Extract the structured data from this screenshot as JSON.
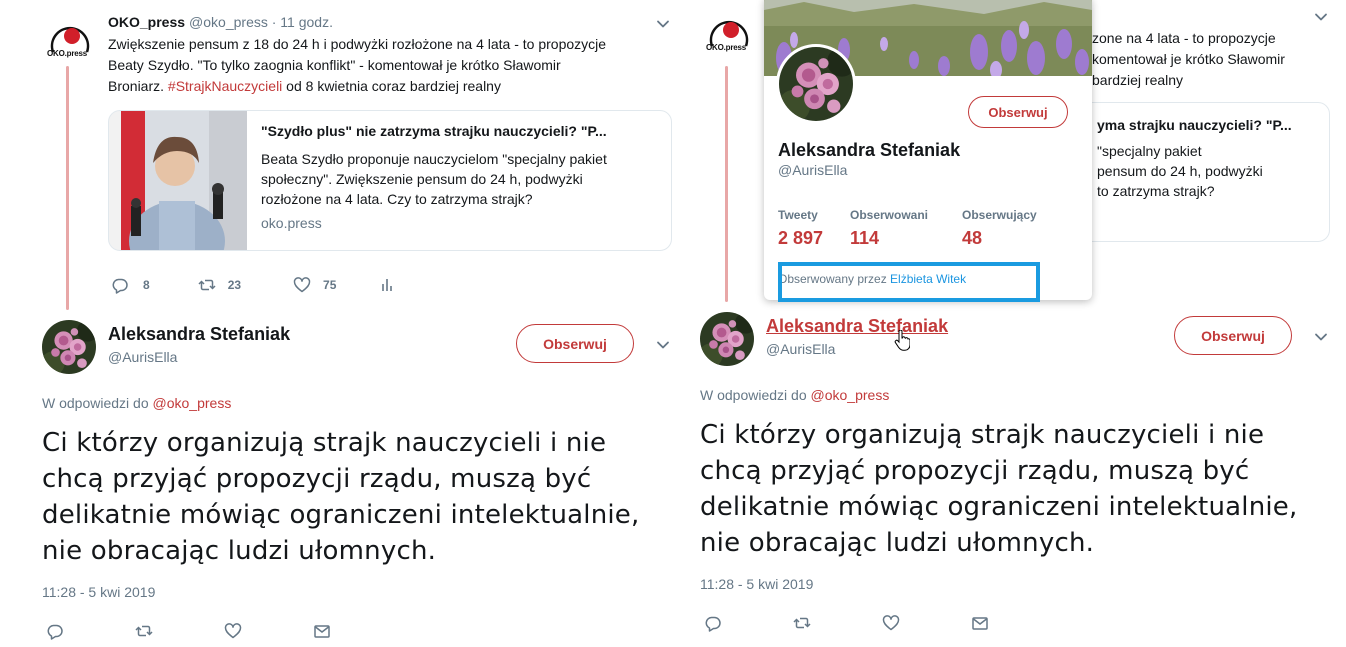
{
  "colors": {
    "accent": "#c23a3a",
    "link_blue": "#1b95e0",
    "muted": "#657786",
    "highlight": "#1a9be0"
  },
  "left": {
    "quoted_tweet": {
      "logo_text": "OKO.press",
      "author_name": "OKO_press",
      "author_meta": "@oko_press · 11 godz.",
      "text_lines": [
        "Zwiększenie pensum z 18 do 24 h i podwyżki rozłożone na 4 lata - to propozycje",
        "Beaty Szydło. \"To tylko zaognia konflikt\" - komentował je krótko Sławomir"
      ],
      "text_line3_before": "Broniarz. ",
      "hashtag": "#StrajkNauczycieli",
      "text_line3_after": " od 8 kwietnia coraz bardziej realny",
      "card": {
        "title": "\"Szydło plus\" nie zatrzyma strajku nauczycieli? \"P...",
        "description_lines": [
          "Beata Szydło proponuje nauczycielom \"specjalny pakiet",
          "społeczny\". Zwiększenie pensum do 24 h, podwyżki",
          "rozłożone na 4 lata. Czy to zatrzyma strajk?"
        ],
        "domain": "oko.press"
      },
      "actions": {
        "replies": "8",
        "retweets": "23",
        "likes": "75"
      }
    },
    "reply": {
      "name": "Aleksandra Stefaniak",
      "handle": "@AurisElla",
      "follow_label": "Obserwuj",
      "reply_prefix": "W odpowiedzi do ",
      "reply_mention": "@oko_press",
      "text_lines": [
        "Ci którzy organizują strajk nauczycieli i nie",
        "chcą przyjąć propozycji rządu, muszą być",
        "delikatnie mówiąc ograniczeni intelektualnie,",
        "nie obracając ludzi ułomnych."
      ],
      "timestamp": "11:28 - 5 kwi 2019"
    }
  },
  "right": {
    "quoted_tweet": {
      "text_lines": [
        "zone na 4 lata - to propozycje",
        "komentował je krótko Sławomir",
        "bardziej realny"
      ],
      "card": {
        "title": "yma strajku nauczycieli? \"P...",
        "description_lines": [
          "\"specjalny pakiet",
          "pensum do 24 h, podwyżki",
          "to zatrzyma strajk?"
        ]
      }
    },
    "hovercard": {
      "name": "Aleksandra Stefaniak",
      "handle": "@AurisElla",
      "follow_label": "Obserwuj",
      "stats": [
        {
          "label": "Tweety",
          "value": "2 897"
        },
        {
          "label": "Obserwowani",
          "value": "114"
        },
        {
          "label": "Obserwujący",
          "value": "48"
        }
      ],
      "followed_by_prefix": "Obserwowany przez ",
      "followed_by_name": "Elżbieta Witek"
    },
    "reply": {
      "name": "Aleksandra Stefaniak",
      "handle": "@AurisElla",
      "follow_label": "Obserwuj",
      "reply_prefix": "W odpowiedzi do ",
      "reply_mention": "@oko_press",
      "text_lines": [
        "Ci którzy organizują strajk nauczycieli i nie",
        "chcą przyjąć propozycji rządu, muszą być",
        "delikatnie mówiąc ograniczeni intelektualnie,",
        "nie obracając ludzi ułomnych."
      ],
      "timestamp": "11:28 - 5 kwi 2019"
    }
  }
}
